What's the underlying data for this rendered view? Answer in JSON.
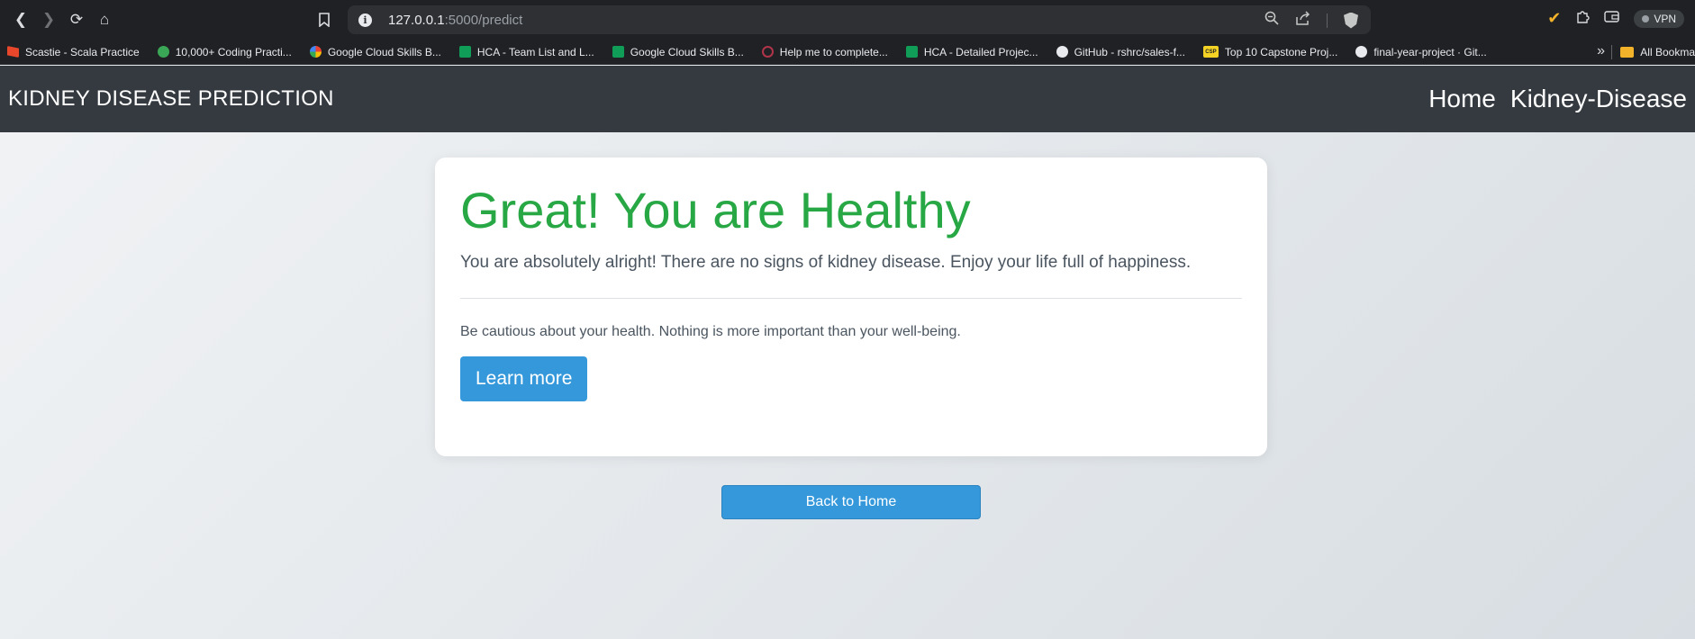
{
  "browser": {
    "url_host": "127.0.0.1",
    "url_path": ":5000/predict",
    "vpn_label": "VPN",
    "bookmarks": [
      {
        "label": "Scastie - Scala Practice",
        "icon": "scastie-icon"
      },
      {
        "label": "10,000+ Coding Practi...",
        "icon": "clock-icon"
      },
      {
        "label": "Google Cloud Skills B...",
        "icon": "google-cloud-icon"
      },
      {
        "label": "HCA - Team List and L...",
        "icon": "sheets-icon"
      },
      {
        "label": "Google Cloud Skills B...",
        "icon": "sheets-icon"
      },
      {
        "label": "Help me to complete...",
        "icon": "help-icon"
      },
      {
        "label": "HCA - Detailed Projec...",
        "icon": "sheets-icon"
      },
      {
        "label": "GitHub - rshrc/sales-f...",
        "icon": "github-icon"
      },
      {
        "label": "Top 10 Capstone Proj...",
        "icon": "csp-icon"
      },
      {
        "label": "final-year-project · Git...",
        "icon": "github-icon"
      }
    ],
    "bookmarks_more": "»",
    "all_bookmarks": "All Bookma"
  },
  "app": {
    "brand": "KIDNEY DISEASE PREDICTION",
    "nav": [
      "Home",
      "Kidney-Disease"
    ]
  },
  "result": {
    "heading": "Great! You are Healthy",
    "lead": "You are absolutely alright! There are no signs of kidney disease. Enjoy your life full of happiness.",
    "note": "Be cautious about your health. Nothing is more important than your well-being.",
    "learn_more": "Learn more",
    "back_home": "Back to Home"
  },
  "colors": {
    "success": "#28a745",
    "primary": "#3498db",
    "navbar": "#343a40"
  }
}
